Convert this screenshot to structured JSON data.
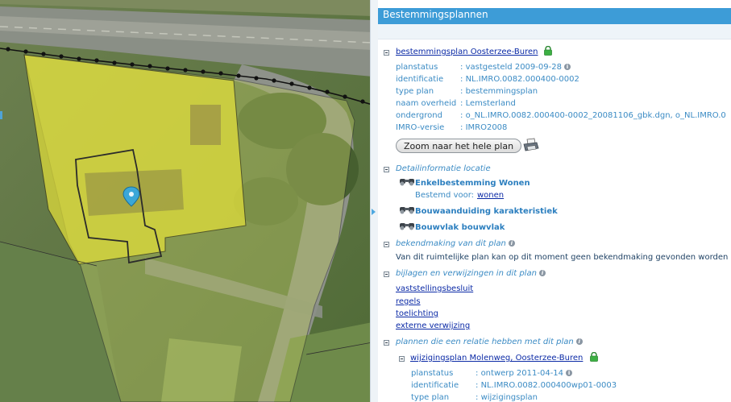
{
  "panel": {
    "title": "Bestemmingsplannen",
    "plan": {
      "name": "bestemmingsplan Oosterzee-Buren",
      "fields": [
        {
          "label": "planstatus",
          "value": "vastgesteld 2009-09-28",
          "info": true
        },
        {
          "label": "identificatie",
          "value": "NL.IMRO.0082.000400-0002",
          "info": false
        },
        {
          "label": "type plan",
          "value": "bestemmingsplan",
          "info": false
        },
        {
          "label": "naam overheid",
          "value": "Lemsterland",
          "info": false
        },
        {
          "label": "ondergrond",
          "value": "o_NL.IMRO.0082.000400-0002_20081106_gbk.dgn, o_NL.IMRO.0",
          "info": false
        },
        {
          "label": "IMRO-versie",
          "value": "IMRO2008",
          "info": false
        }
      ],
      "zoom_button": "Zoom naar het hele plan"
    },
    "detail": {
      "title": "Detailinformatie locatie",
      "items": [
        {
          "name": "Enkelbestemming Wonen",
          "sub_label": "Bestemd voor:",
          "sub_link": "wonen"
        },
        {
          "name": "Bouwaanduiding karakteristiek"
        },
        {
          "name": "Bouwvlak bouwvlak"
        }
      ]
    },
    "bekendmaking": {
      "title": "bekendmaking van dit plan",
      "text": "Van dit ruimtelijke plan kan op dit moment geen bekendmaking gevonden worden"
    },
    "bijlagen": {
      "title": "bijlagen en verwijzingen in dit plan",
      "links": [
        "vaststellingsbesluit",
        "regels",
        "toelichting",
        "externe verwijzing"
      ]
    },
    "relaties": {
      "title": "plannen die een relatie hebben met dit plan",
      "plan": {
        "name": "wijzigingsplan Molenweg, Oosterzee-Buren",
        "fields": [
          {
            "label": "planstatus",
            "value": "ontwerp 2011-04-14",
            "info": true
          },
          {
            "label": "identificatie",
            "value": "NL.IMRO.0082.000400wp01-0003",
            "info": false
          },
          {
            "label": "type plan",
            "value": "wijzigingsplan",
            "info": false
          }
        ]
      }
    }
  },
  "colors": {
    "header": "#3d9cd7",
    "plan_area": "#e6e23a",
    "marker": "#3aa7d8",
    "lock": "#3cb043"
  },
  "icons": [
    "collapse-icon",
    "lock-icon",
    "info-icon",
    "binoculars-icon",
    "printer-icon",
    "map-marker-icon"
  ]
}
